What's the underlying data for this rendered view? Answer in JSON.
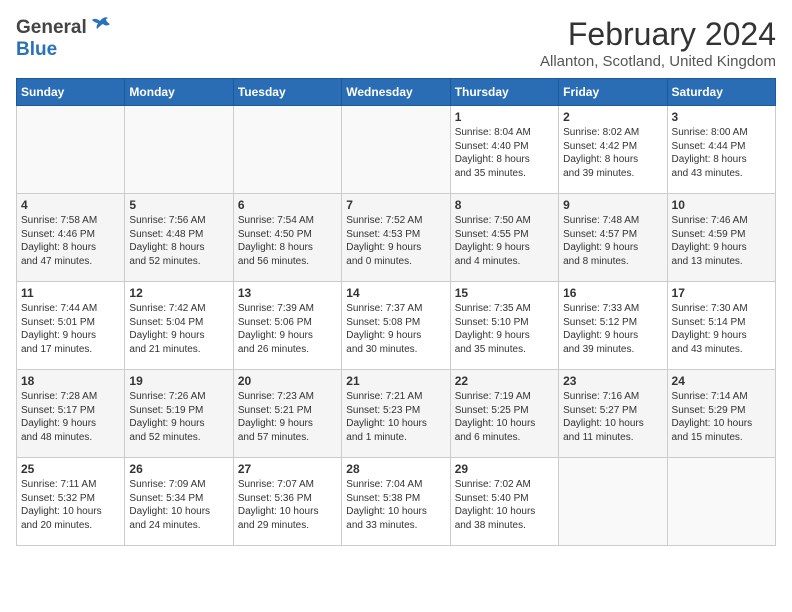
{
  "header": {
    "logo_general": "General",
    "logo_blue": "Blue",
    "month": "February 2024",
    "location": "Allanton, Scotland, United Kingdom"
  },
  "days_of_week": [
    "Sunday",
    "Monday",
    "Tuesday",
    "Wednesday",
    "Thursday",
    "Friday",
    "Saturday"
  ],
  "weeks": [
    [
      {
        "day": "",
        "detail": ""
      },
      {
        "day": "",
        "detail": ""
      },
      {
        "day": "",
        "detail": ""
      },
      {
        "day": "",
        "detail": ""
      },
      {
        "day": "1",
        "detail": "Sunrise: 8:04 AM\nSunset: 4:40 PM\nDaylight: 8 hours\nand 35 minutes."
      },
      {
        "day": "2",
        "detail": "Sunrise: 8:02 AM\nSunset: 4:42 PM\nDaylight: 8 hours\nand 39 minutes."
      },
      {
        "day": "3",
        "detail": "Sunrise: 8:00 AM\nSunset: 4:44 PM\nDaylight: 8 hours\nand 43 minutes."
      }
    ],
    [
      {
        "day": "4",
        "detail": "Sunrise: 7:58 AM\nSunset: 4:46 PM\nDaylight: 8 hours\nand 47 minutes."
      },
      {
        "day": "5",
        "detail": "Sunrise: 7:56 AM\nSunset: 4:48 PM\nDaylight: 8 hours\nand 52 minutes."
      },
      {
        "day": "6",
        "detail": "Sunrise: 7:54 AM\nSunset: 4:50 PM\nDaylight: 8 hours\nand 56 minutes."
      },
      {
        "day": "7",
        "detail": "Sunrise: 7:52 AM\nSunset: 4:53 PM\nDaylight: 9 hours\nand 0 minutes."
      },
      {
        "day": "8",
        "detail": "Sunrise: 7:50 AM\nSunset: 4:55 PM\nDaylight: 9 hours\nand 4 minutes."
      },
      {
        "day": "9",
        "detail": "Sunrise: 7:48 AM\nSunset: 4:57 PM\nDaylight: 9 hours\nand 8 minutes."
      },
      {
        "day": "10",
        "detail": "Sunrise: 7:46 AM\nSunset: 4:59 PM\nDaylight: 9 hours\nand 13 minutes."
      }
    ],
    [
      {
        "day": "11",
        "detail": "Sunrise: 7:44 AM\nSunset: 5:01 PM\nDaylight: 9 hours\nand 17 minutes."
      },
      {
        "day": "12",
        "detail": "Sunrise: 7:42 AM\nSunset: 5:04 PM\nDaylight: 9 hours\nand 21 minutes."
      },
      {
        "day": "13",
        "detail": "Sunrise: 7:39 AM\nSunset: 5:06 PM\nDaylight: 9 hours\nand 26 minutes."
      },
      {
        "day": "14",
        "detail": "Sunrise: 7:37 AM\nSunset: 5:08 PM\nDaylight: 9 hours\nand 30 minutes."
      },
      {
        "day": "15",
        "detail": "Sunrise: 7:35 AM\nSunset: 5:10 PM\nDaylight: 9 hours\nand 35 minutes."
      },
      {
        "day": "16",
        "detail": "Sunrise: 7:33 AM\nSunset: 5:12 PM\nDaylight: 9 hours\nand 39 minutes."
      },
      {
        "day": "17",
        "detail": "Sunrise: 7:30 AM\nSunset: 5:14 PM\nDaylight: 9 hours\nand 43 minutes."
      }
    ],
    [
      {
        "day": "18",
        "detail": "Sunrise: 7:28 AM\nSunset: 5:17 PM\nDaylight: 9 hours\nand 48 minutes."
      },
      {
        "day": "19",
        "detail": "Sunrise: 7:26 AM\nSunset: 5:19 PM\nDaylight: 9 hours\nand 52 minutes."
      },
      {
        "day": "20",
        "detail": "Sunrise: 7:23 AM\nSunset: 5:21 PM\nDaylight: 9 hours\nand 57 minutes."
      },
      {
        "day": "21",
        "detail": "Sunrise: 7:21 AM\nSunset: 5:23 PM\nDaylight: 10 hours\nand 1 minute."
      },
      {
        "day": "22",
        "detail": "Sunrise: 7:19 AM\nSunset: 5:25 PM\nDaylight: 10 hours\nand 6 minutes."
      },
      {
        "day": "23",
        "detail": "Sunrise: 7:16 AM\nSunset: 5:27 PM\nDaylight: 10 hours\nand 11 minutes."
      },
      {
        "day": "24",
        "detail": "Sunrise: 7:14 AM\nSunset: 5:29 PM\nDaylight: 10 hours\nand 15 minutes."
      }
    ],
    [
      {
        "day": "25",
        "detail": "Sunrise: 7:11 AM\nSunset: 5:32 PM\nDaylight: 10 hours\nand 20 minutes."
      },
      {
        "day": "26",
        "detail": "Sunrise: 7:09 AM\nSunset: 5:34 PM\nDaylight: 10 hours\nand 24 minutes."
      },
      {
        "day": "27",
        "detail": "Sunrise: 7:07 AM\nSunset: 5:36 PM\nDaylight: 10 hours\nand 29 minutes."
      },
      {
        "day": "28",
        "detail": "Sunrise: 7:04 AM\nSunset: 5:38 PM\nDaylight: 10 hours\nand 33 minutes."
      },
      {
        "day": "29",
        "detail": "Sunrise: 7:02 AM\nSunset: 5:40 PM\nDaylight: 10 hours\nand 38 minutes."
      },
      {
        "day": "",
        "detail": ""
      },
      {
        "day": "",
        "detail": ""
      }
    ]
  ]
}
